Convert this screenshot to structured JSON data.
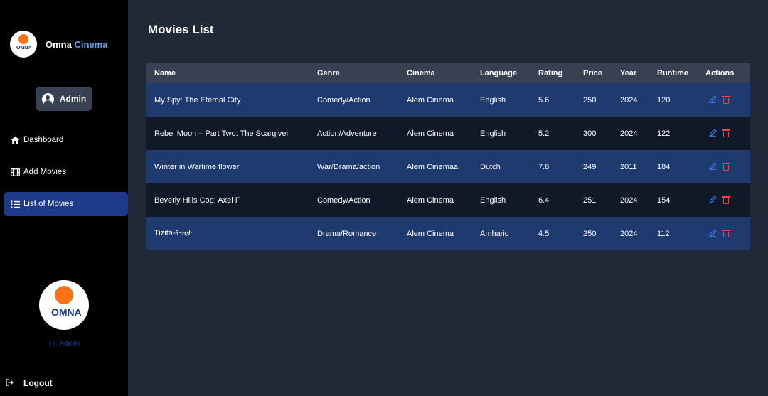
{
  "brand": {
    "logo_text": "OMNA",
    "name_prefix": "Omna",
    "name_accent": "Cinema"
  },
  "user": {
    "label": "Admin"
  },
  "nav": {
    "items": [
      {
        "label": "Dashboard",
        "icon": "home-icon",
        "active": false
      },
      {
        "label": "Add Movies",
        "icon": "film-icon",
        "active": false
      },
      {
        "label": "List of Movies",
        "icon": "list-icon",
        "active": true
      }
    ]
  },
  "sidebar_footer": {
    "big_logo_text": "OMNA",
    "greeting": "Hi, Admin",
    "logout_label": "Logout"
  },
  "main": {
    "title": "Movies List",
    "columns": [
      "Name",
      "Genre",
      "Cinema",
      "Language",
      "Rating",
      "Price",
      "Year",
      "Runtime",
      "Actions"
    ],
    "rows": [
      {
        "name": "My Spy: The Eternal City",
        "genre": "Comedy/Action",
        "cinema": "Alem Cinema",
        "language": "English",
        "rating": "5.6",
        "price": "250",
        "year": "2024",
        "runtime": "120"
      },
      {
        "name": "Rebel Moon – Part Two: The Scargiver",
        "genre": "Action/Adventure",
        "cinema": "Alem Cinema",
        "language": "English",
        "rating": "5.2",
        "price": "300",
        "year": "2024",
        "runtime": "122"
      },
      {
        "name": "Winter in Wartime flower",
        "genre": "War/Drama/action",
        "cinema": "Alem Cinemaa",
        "language": "Dutch",
        "rating": "7.8",
        "price": "249",
        "year": "2011",
        "runtime": "184"
      },
      {
        "name": "Beverly Hills Cop: Axel F",
        "genre": "Comedy/Action",
        "cinema": "Alem Cinema",
        "language": "English",
        "rating": "6.4",
        "price": "251",
        "year": "2024",
        "runtime": "154"
      },
      {
        "name": "Tizita-ትዝታ",
        "genre": "Drama/Romance",
        "cinema": "Alem Cinema",
        "language": "Amharic",
        "rating": "4.5",
        "price": "250",
        "year": "2024",
        "runtime": "112"
      }
    ]
  },
  "colors": {
    "sidebar_bg": "#000000",
    "main_bg": "#1f2937",
    "accent": "#60a5fa",
    "active_nav": "#1e3a8a",
    "row_odd": "#1e3a6e",
    "row_even": "#111827",
    "edit": "#3b82f6",
    "delete": "#ef4444"
  }
}
